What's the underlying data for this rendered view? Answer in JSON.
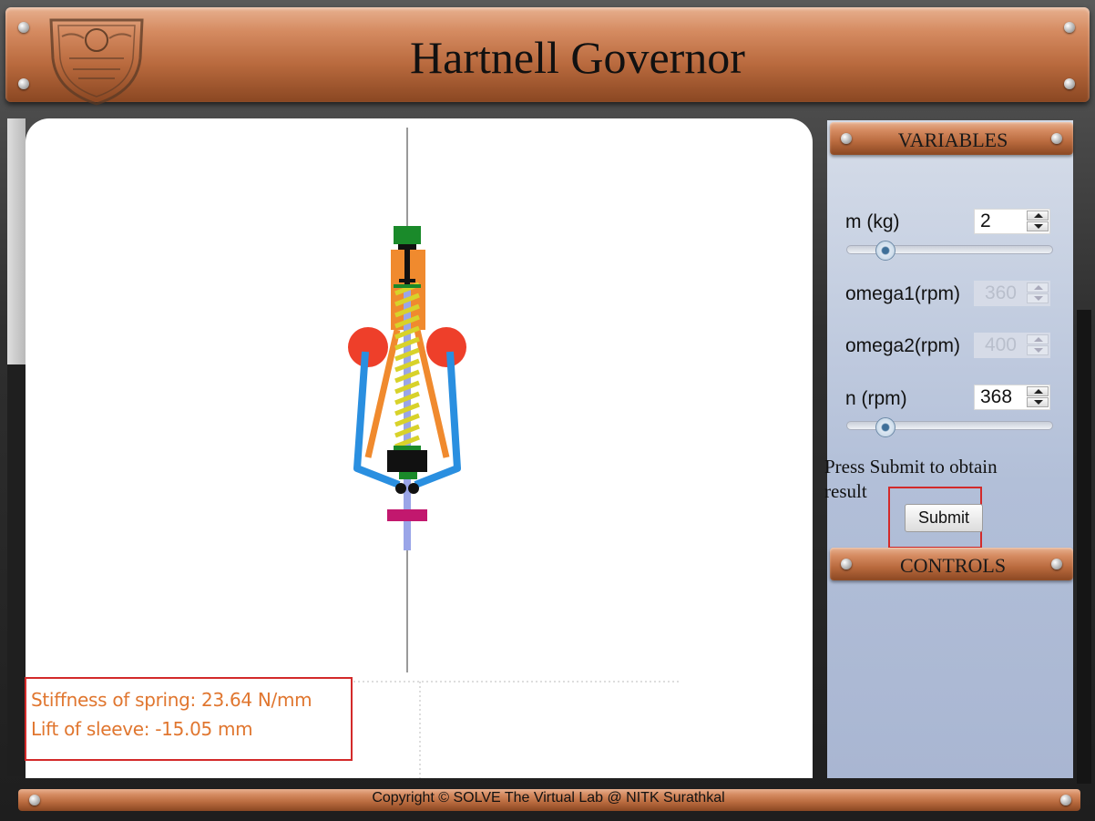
{
  "header": {
    "title": "Hartnell Governor"
  },
  "variables_panel": {
    "title": "VARIABLES",
    "fields": [
      {
        "label": "m (kg)",
        "value": "2",
        "enabled": true,
        "slider_fraction": 0.18
      },
      {
        "label": "omega1(rpm)",
        "value": "360",
        "enabled": false
      },
      {
        "label": "omega2(rpm)",
        "value": "400",
        "enabled": false
      },
      {
        "label": "n (rpm)",
        "value": "368",
        "enabled": true,
        "slider_fraction": 0.18
      }
    ],
    "hint": "Press Submit to obtain result",
    "submit_label": "Submit"
  },
  "controls_panel": {
    "title": "CONTROLS"
  },
  "results": {
    "stiffness": "Stiffness of spring: 23.64 N/mm",
    "lift": "Lift of sleeve: -15.05 mm"
  },
  "footer": {
    "copyright": "Copyright © SOLVE The Virtual Lab @ NITK Surathkal"
  },
  "colors": {
    "wood": "#b96a3e",
    "panel": "#b2bfd8",
    "highlight_box": "#d32a2a",
    "result_text": "#e0762f",
    "ball": "#ee3f2a",
    "arm_blue": "#2a8fe0",
    "arm_orange": "#f08a2e",
    "spring": "#d8d22a",
    "collar_green": "#1a8a2a",
    "sleeve_magenta": "#c2186e",
    "spindle": "#9aa5e8"
  },
  "icons": [
    "nitk-logo-icon",
    "rivet-icon",
    "spin-up-icon",
    "spin-down-icon",
    "slider-thumb-icon"
  ]
}
